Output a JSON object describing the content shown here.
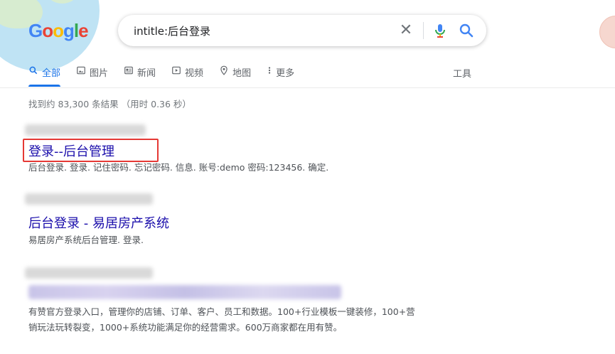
{
  "logo": {
    "letters": [
      "G",
      "o",
      "o",
      "g",
      "l",
      "e"
    ]
  },
  "search": {
    "query": "intitle:后台登录"
  },
  "tabs": [
    {
      "label": "全部",
      "icon": "search-icon"
    },
    {
      "label": "图片",
      "icon": "image-icon"
    },
    {
      "label": "新闻",
      "icon": "news-icon"
    },
    {
      "label": "视频",
      "icon": "video-icon"
    },
    {
      "label": "地图",
      "icon": "map-pin-icon"
    },
    {
      "label": "更多",
      "icon": "more-vertical-icon"
    }
  ],
  "tools_label": "工具",
  "stats": "找到约 83,300 条结果  （用时 0.36 秒）",
  "results": [
    {
      "title": "登录--后台管理",
      "snippet": "后台登录. 登录. 记住密码. 忘记密码. 信息. 账号:demo 密码:123456. 确定."
    },
    {
      "title": "后台登录 - 易居房产系统",
      "snippet": "易居房产系统后台管理. 登录."
    },
    {
      "snippet_line1": "有赞官方登录入口，管理你的店铺、订单、客户、员工和数据。100+行业模板一键装修，100+营",
      "snippet_line2": "销玩法玩转裂变，1000+系统功能满足你的经营需求。600万商家都在用有赞。"
    }
  ],
  "colors": {
    "link": "#1a0dab",
    "active_tab": "#1a73e8",
    "highlight": "#e53935"
  }
}
